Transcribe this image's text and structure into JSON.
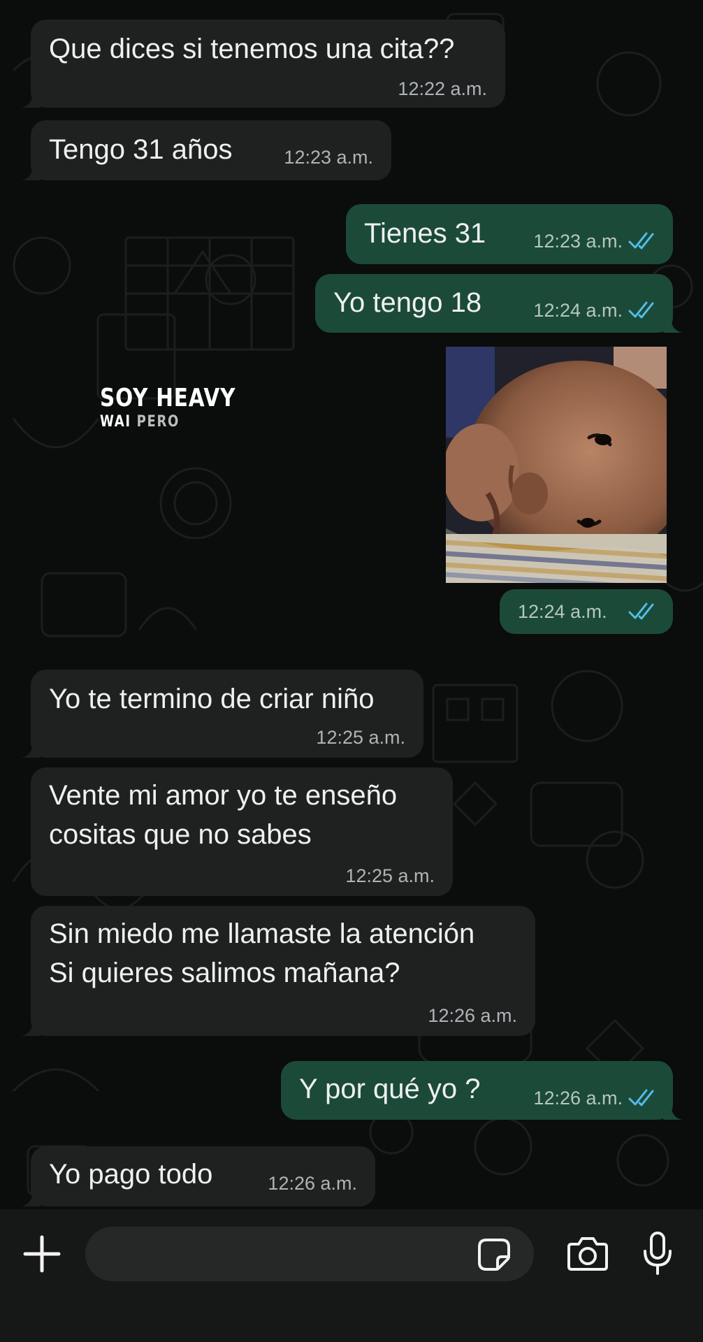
{
  "messages": [
    {
      "dir": "in",
      "text": "Que dices si tenemos una cita??",
      "time": "12:22 a.m."
    },
    {
      "dir": "in",
      "text": "Tengo 31 años",
      "time": "12:23 a.m."
    },
    {
      "dir": "out",
      "text": "Tienes 31",
      "time": "12:23 a.m."
    },
    {
      "dir": "out",
      "text": "Yo tengo 18",
      "time": "12:24 a.m."
    },
    {
      "dir": "out",
      "text": "",
      "time": "12:24 a.m."
    },
    {
      "dir": "in",
      "text": "Yo te termino de criar niño",
      "time": "12:25 a.m."
    },
    {
      "dir": "in",
      "line1": "Vente mi amor yo te enseño",
      "line2": "cositas que no sabes",
      "time": "12:25 a.m."
    },
    {
      "dir": "in",
      "line1": "Sin miedo me llamaste la atención",
      "line2": "Si quieres salimos mañana?",
      "time": "12:26 a.m."
    },
    {
      "dir": "out",
      "text": "Y por qué yo ?",
      "time": "12:26 a.m."
    },
    {
      "dir": "in",
      "text": "Yo pago todo",
      "time": "12:26 a.m."
    }
  ],
  "watermark": {
    "title": "SOY HEAVY",
    "sub_a": "WAI",
    "sub_b": "PERO"
  },
  "composer": {
    "value": "",
    "placeholder": ""
  },
  "icons": {
    "attach": "plus-icon",
    "sticker": "sticker-icon",
    "camera": "camera-icon",
    "mic": "microphone-icon",
    "read": "double-check-icon"
  },
  "colors": {
    "incoming": "#1f2121",
    "outgoing": "#1c4a38",
    "read_ticks": "#53bdeb",
    "background": "#0b0c0c"
  }
}
